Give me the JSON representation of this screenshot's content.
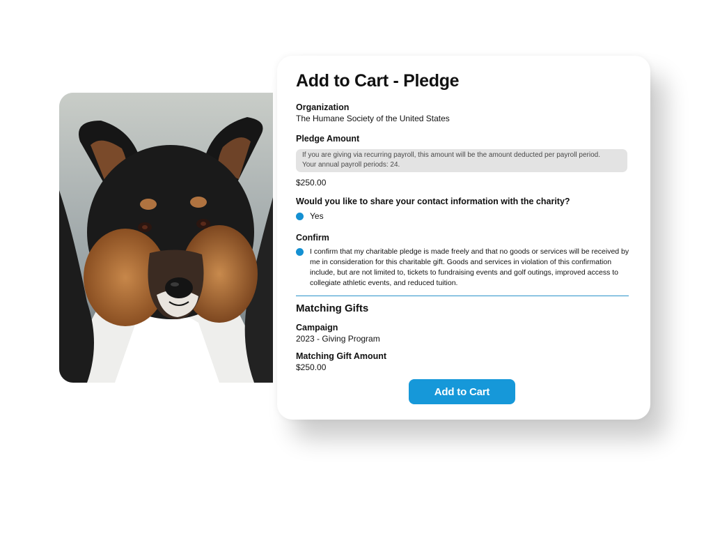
{
  "header": {
    "title": "Add to Cart - Pledge"
  },
  "organization": {
    "label": "Organization",
    "value": "The Humane Society of the United States"
  },
  "pledge": {
    "label": "Pledge Amount",
    "note_line1": "If you are giving via recurring payroll, this amount will be the amount deducted per payroll period.",
    "note_line2": "Your annual payroll periods: 24.",
    "amount": "$250.00"
  },
  "share_contact": {
    "question": "Would you like to share your contact information with the charity?",
    "option_label": "Yes"
  },
  "confirm": {
    "label": "Confirm",
    "text": "I confirm that my charitable pledge is made freely and that no goods or services will be received by me in consideration for this charitable gift. Goods and services in violation of this confirmation include, but are not limited to, tickets to fundraising events and golf outings, improved access to collegiate athletic events, and reduced tuition."
  },
  "matching": {
    "section_title": "Matching Gifts",
    "campaign_label": "Campaign",
    "campaign_value": "2023 - Giving Program",
    "amount_label": "Matching Gift Amount",
    "amount_value": "$250.00"
  },
  "actions": {
    "add_to_cart_label": "Add to Cart"
  },
  "colors": {
    "accent": "#1698d9",
    "radio": "#1490d2",
    "divider": "#2a93c9",
    "note_bg": "#e3e3e3"
  },
  "image": {
    "subject": "dog-photo"
  }
}
